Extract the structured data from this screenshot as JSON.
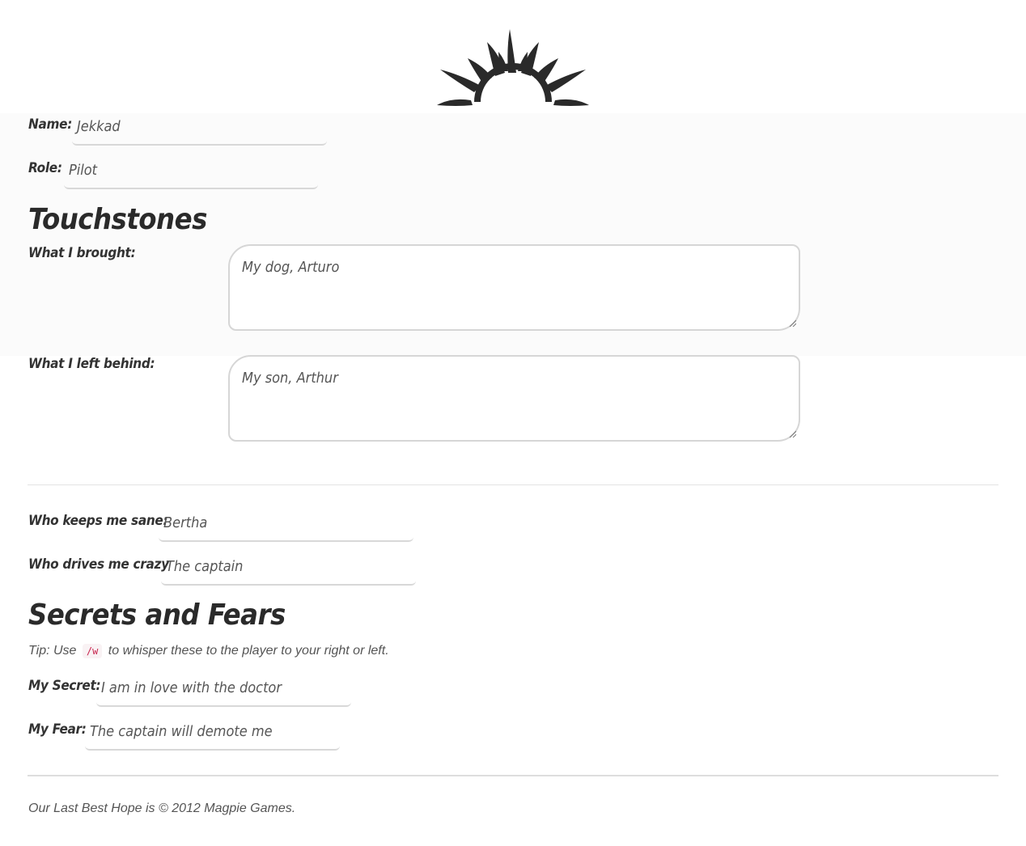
{
  "logo": {
    "icon": "sunburst-logo"
  },
  "fields": {
    "name": {
      "label": "Name:",
      "value": "Jekkad"
    },
    "role": {
      "label": "Role:",
      "value": "Pilot"
    }
  },
  "touchstones": {
    "heading": "Touchstones",
    "brought": {
      "label": "What I brought:",
      "value": "My dog, Arturo"
    },
    "left_behind": {
      "label": "What I left behind:",
      "value": "My son, Arthur"
    }
  },
  "relations": {
    "sane": {
      "label": "Who keeps me sane:",
      "value": "Bertha"
    },
    "crazy": {
      "label": "Who drives me crazy",
      "value": "The captain"
    }
  },
  "secrets": {
    "heading": "Secrets and Fears",
    "tip_prefix": "Tip: Use",
    "tip_code": "/w",
    "tip_suffix": "to whisper these to the player to your right or left.",
    "secret": {
      "label": "My Secret:",
      "value": "I am in love with the doctor"
    },
    "fear": {
      "label": "My Fear:",
      "value": "The captain will demote me"
    }
  },
  "footer": {
    "text": "Our Last Best Hope is © 2012 Magpie Games."
  },
  "colors": {
    "text": "#333333",
    "field_border": "#d8d8d8",
    "code_text": "#c7254e",
    "code_bg": "#f9f2f4"
  }
}
